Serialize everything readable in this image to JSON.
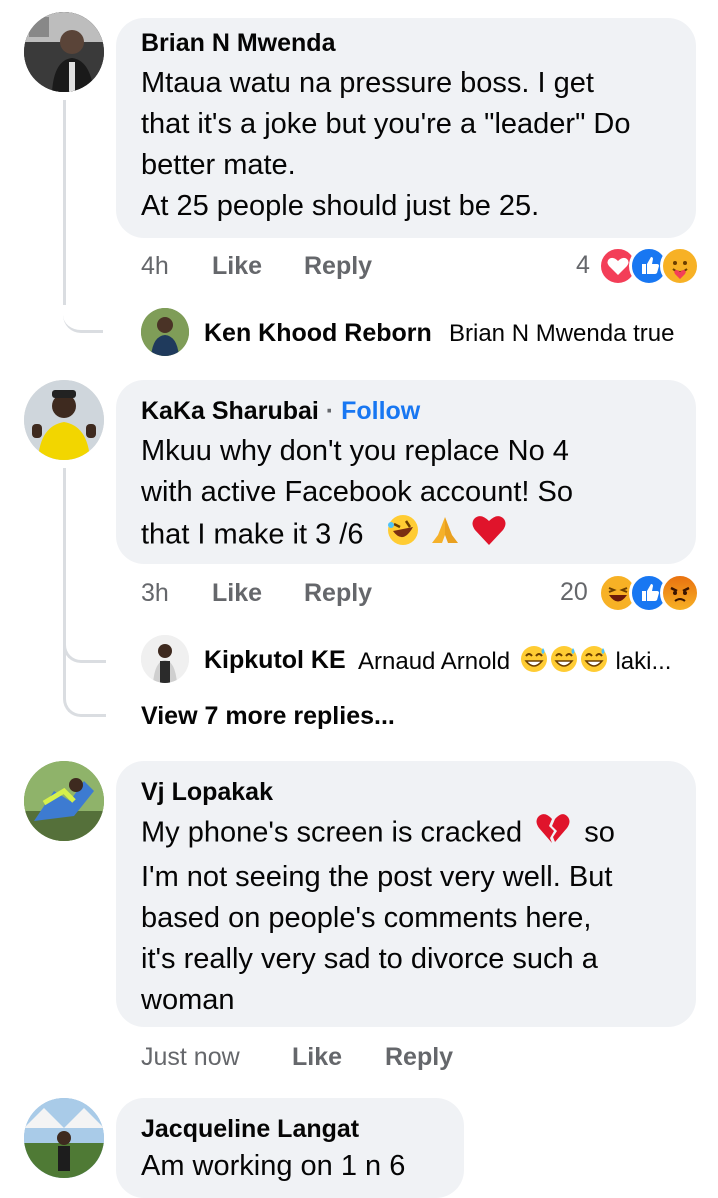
{
  "comments": [
    {
      "author": "Brian N Mwenda",
      "lines": [
        "Mtaua watu na pressure boss. I get",
        "that it's a joke but you're a \"leader\" Do",
        "better mate.",
        "At 25 people should just be 25."
      ],
      "time": "4h",
      "like": "Like",
      "reply": "Reply",
      "reaction_count": "4",
      "reactions": [
        "love-icon",
        "like-icon",
        "care-icon"
      ]
    },
    {
      "author": "KaKa Sharubai",
      "separator": "·",
      "follow": "Follow",
      "lines": [
        "Mkuu why don't you replace No 4",
        "with active Facebook account! So",
        "that I make it 3 /6"
      ],
      "trailing_emojis": [
        "rolling-laugh-emoji",
        "praying-hands-emoji",
        "red-heart-emoji"
      ],
      "time": "3h",
      "like": "Like",
      "reply": "Reply",
      "reaction_count": "20",
      "reactions": [
        "haha-icon",
        "like-icon",
        "angry-icon"
      ]
    },
    {
      "author": "Vj Lopakak",
      "lines_before_emoji": "My phone's screen is cracked",
      "lines_after_emoji": "so",
      "lines": [
        "I'm not seeing the post very well. But",
        "based on people's comments here,",
        "it's really very sad to divorce such a",
        "woman"
      ],
      "inline_emoji": "broken-heart-emoji",
      "time": "Just now",
      "like": "Like",
      "reply": "Reply"
    },
    {
      "author": "Jacqueline Langat",
      "partial_text": "Am working on 1 n 6"
    }
  ],
  "replies": [
    {
      "author": "Ken Khood Reborn",
      "text": "Brian N Mwenda true"
    },
    {
      "author": "Kipkutol KE",
      "text": "Arnaud Arnold",
      "emojis": [
        "grinning-sweat-emoji",
        "grinning-sweat-emoji",
        "grinning-sweat-emoji"
      ],
      "trailing": "laki..."
    }
  ],
  "view_more": "View 7 more replies...",
  "colors": {
    "bubble": "#f0f2f5",
    "meta": "#65676b",
    "link": "#1877f2",
    "thread": "#dadde1"
  }
}
